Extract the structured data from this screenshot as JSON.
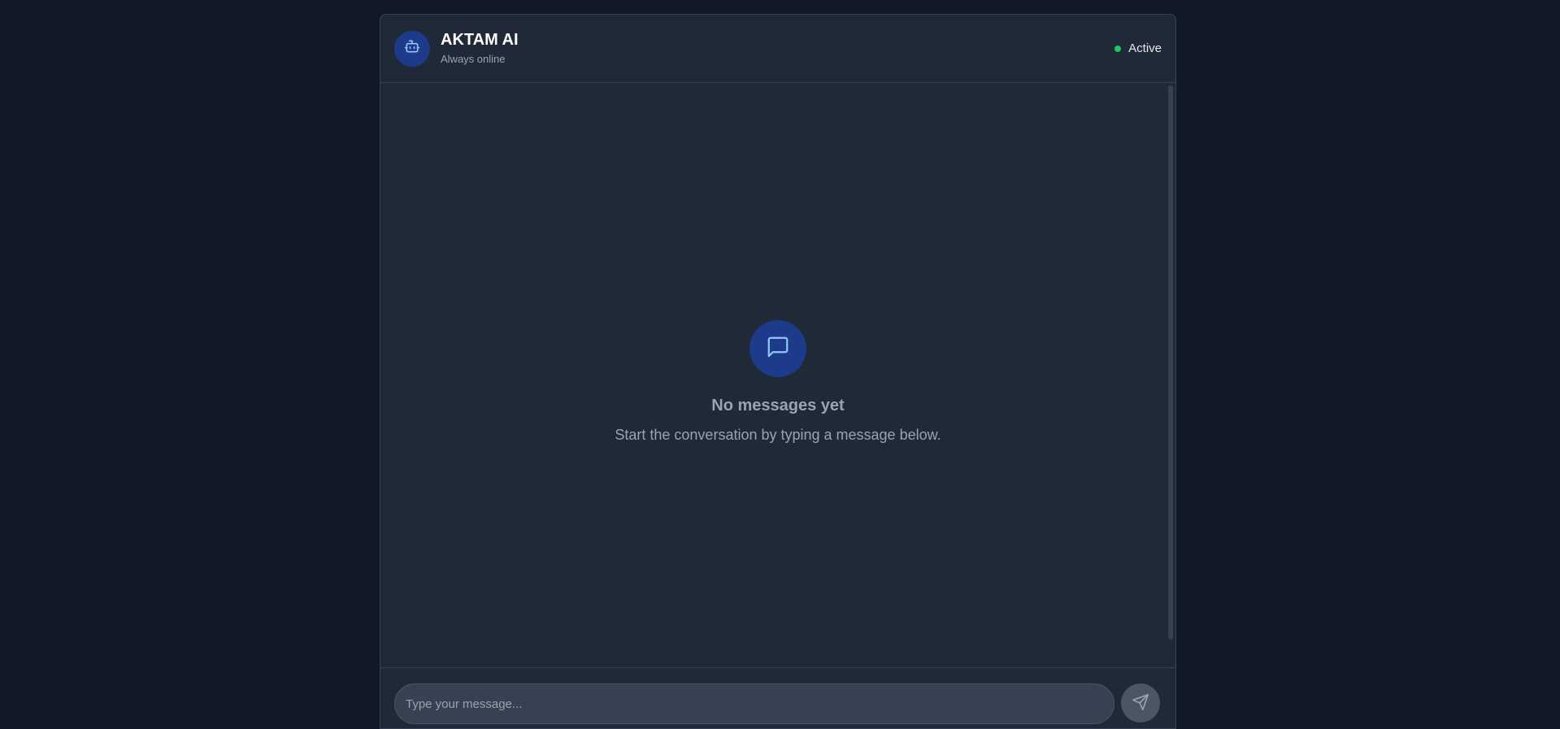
{
  "header": {
    "bot_name": "AKTAM AI",
    "bot_subtitle": "Always online",
    "status_label": "Active",
    "avatar_icon": "bot-icon"
  },
  "empty_state": {
    "icon": "message-square-icon",
    "title": "No messages yet",
    "description": "Start the conversation by typing a message below."
  },
  "composer": {
    "placeholder": "Type your message...",
    "value": "",
    "send_icon": "send-icon"
  },
  "colors": {
    "page_background": "#111827",
    "panel_background": "#1f2937",
    "border": "#374151",
    "accent_circle": "#1e3a8a",
    "icon_stroke": "#93c5fd",
    "status_online": "#22c55e",
    "input_background": "#374151",
    "send_button": "#4b5563"
  }
}
